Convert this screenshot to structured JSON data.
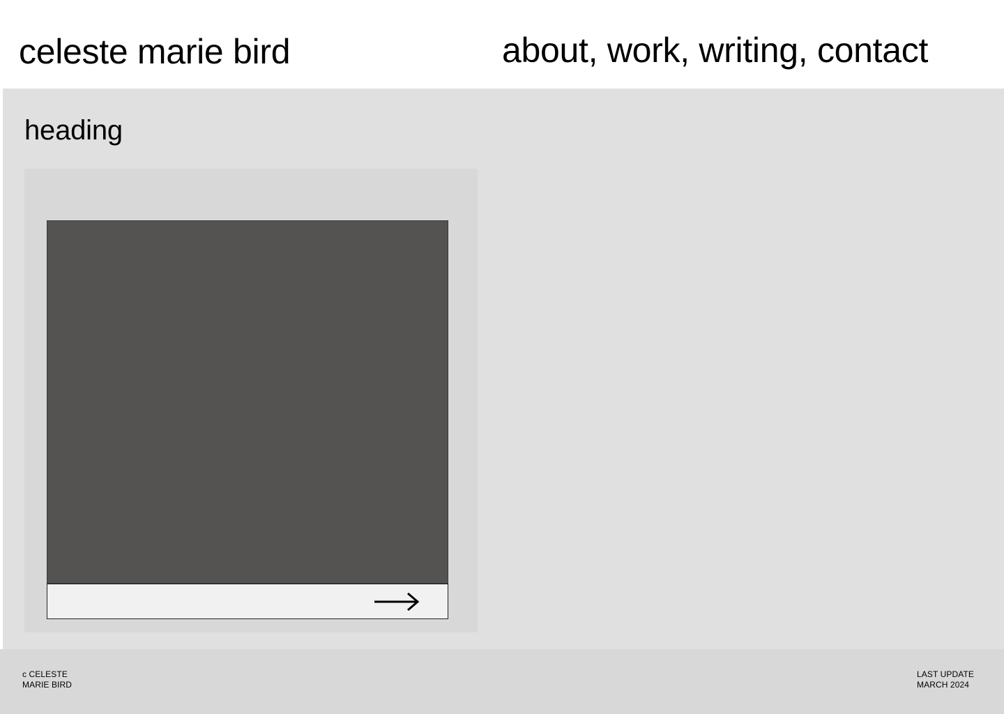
{
  "header": {
    "site_title": "celeste marie bird",
    "nav": {
      "about": "about",
      "work": "work",
      "writing": "writing",
      "contact": "contact",
      "separator": ", "
    }
  },
  "main": {
    "heading": "heading",
    "card": {
      "image_color": "#545351",
      "arrow_icon": "arrow-right-icon"
    }
  },
  "footer": {
    "copyright_line1": "c CELESTE",
    "copyright_line2": "MARIE BIRD",
    "update_line1": "LAST UPDATE",
    "update_line2": "MARCH 2024"
  },
  "colors": {
    "page_bg": "#ffffff",
    "main_bg": "#e0e0e0",
    "card_bg": "#d8d8d8",
    "footer_bg": "#d8d8d8",
    "bar_bg": "#f2f1f1"
  }
}
